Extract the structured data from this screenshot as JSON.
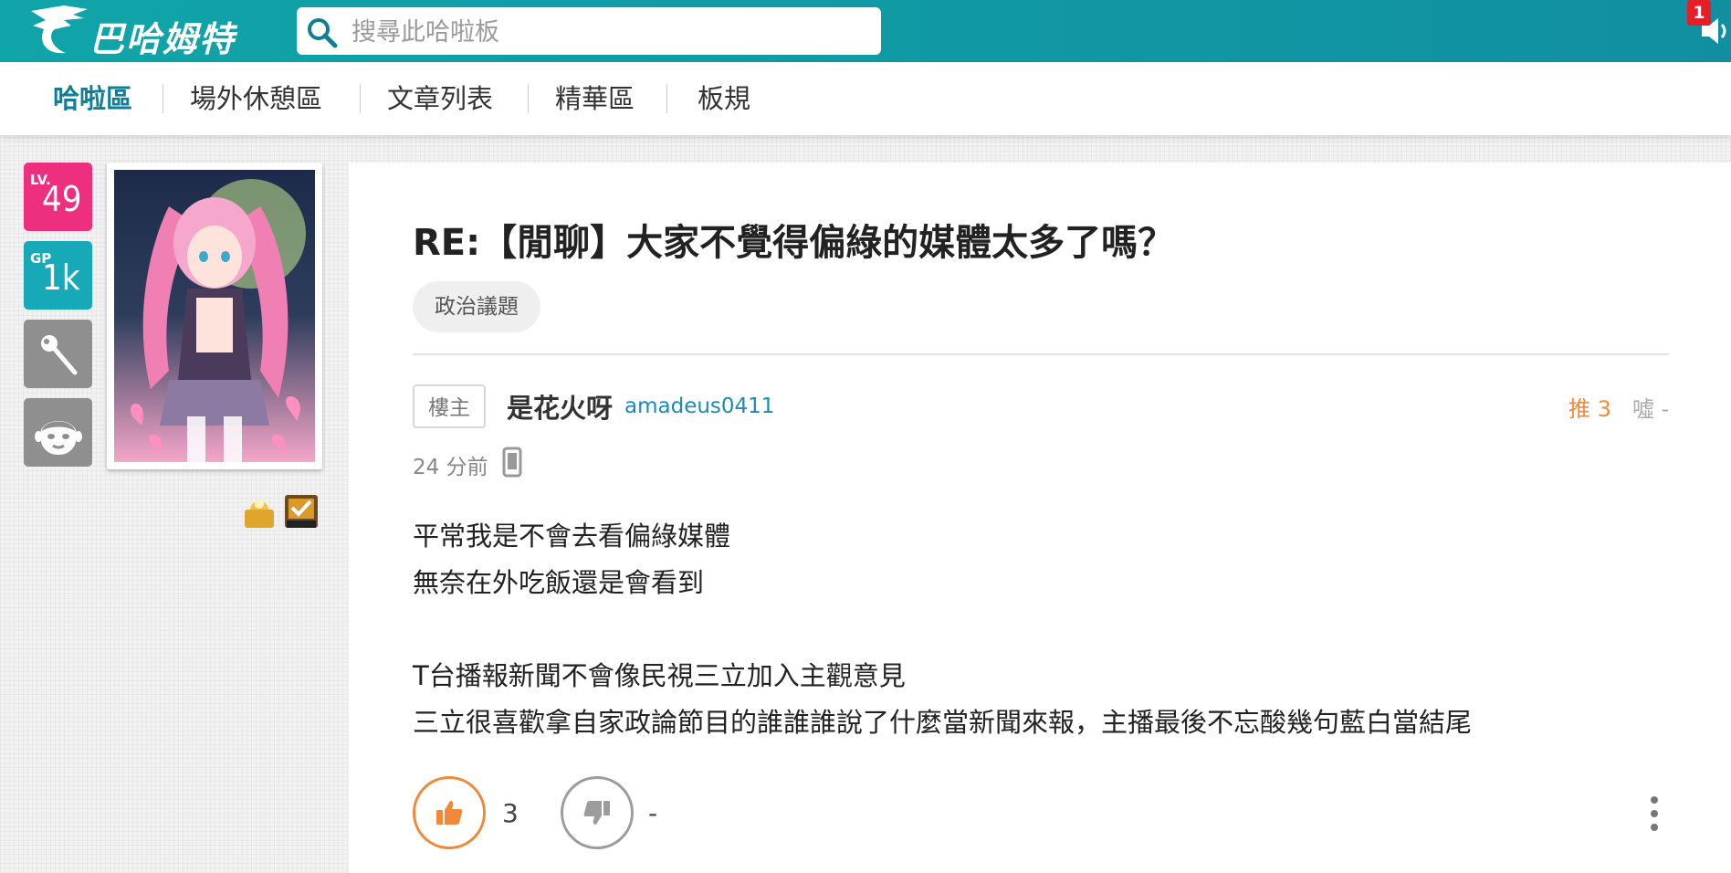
{
  "header": {
    "logo_text": "巴哈姆特",
    "search_placeholder": "搜尋此哈啦板",
    "notification_count": "1"
  },
  "nav": {
    "items": [
      {
        "label": "哈啦區",
        "active": true
      },
      {
        "label": "場外休憩區"
      },
      {
        "label": "文章列表"
      },
      {
        "label": "精華區"
      },
      {
        "label": "板規"
      }
    ]
  },
  "user": {
    "level_prefix": "LV.",
    "level": "49",
    "gp_prefix": "GP",
    "gp": "1k",
    "colors": {
      "level": "#ee2f7f",
      "gp": "#17a9b8",
      "grey": "#8f8f8f"
    }
  },
  "post": {
    "title": "RE:【閒聊】大家不覺得偏綠的媒體太多了嗎？",
    "tag": "政治議題",
    "op_label": "樓主",
    "author_nick": "是花火呀",
    "author_id": "amadeus0411",
    "push_label": "推 3",
    "boo_label": "噓 -",
    "time": "24 分前",
    "content_lines": [
      "平常我是不會去看偏綠媒體",
      "無奈在外吃飯還是會看到",
      "",
      "T台播報新聞不會像民視三立加入主觀意見",
      "三立很喜歡拿自家政論節目的誰誰誰說了什麼當新聞來報，主播最後不忘酸幾句藍白當結尾"
    ],
    "gp_count": "3",
    "bp_count": "-"
  },
  "icons": {
    "search": "search-icon",
    "phone": "mobile-phone-icon",
    "thumbs_up": "thumbs-up-icon",
    "thumbs_down": "thumbs-down-icon",
    "more": "more-vertical-icon"
  }
}
